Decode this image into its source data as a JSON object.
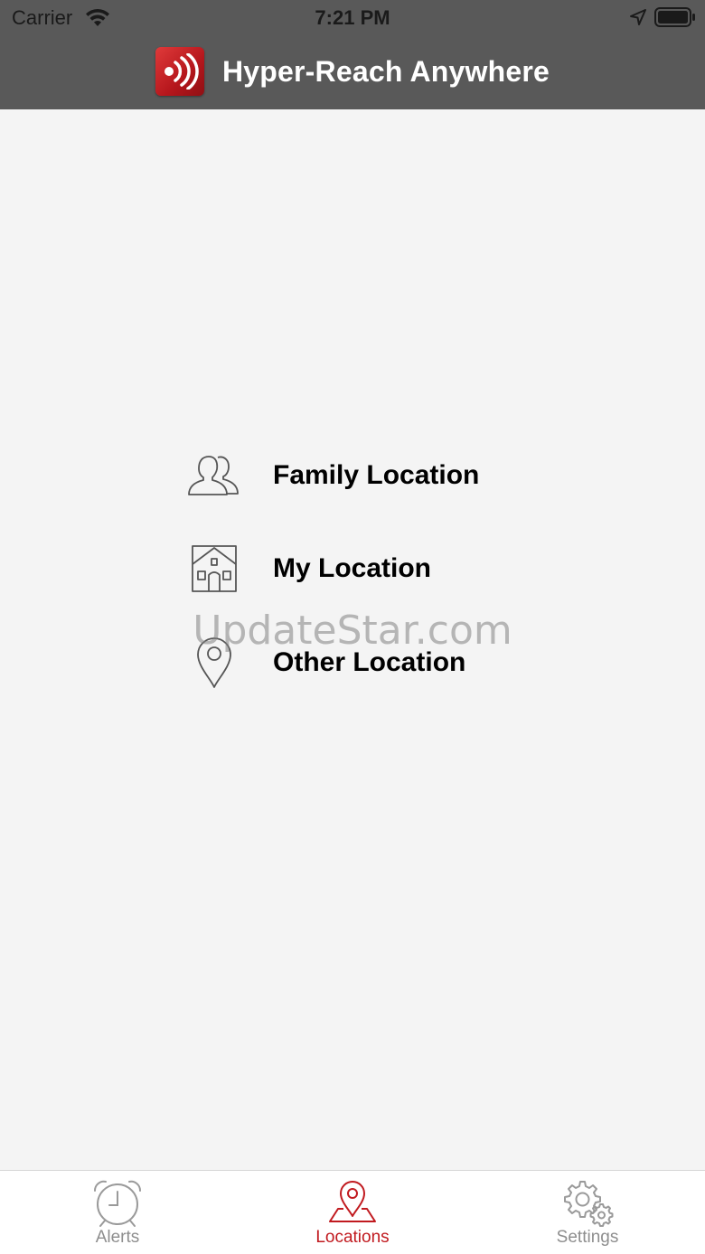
{
  "status_bar": {
    "carrier": "Carrier",
    "time": "7:21 PM"
  },
  "header": {
    "title": "Hyper-Reach Anywhere",
    "logo_icon": "hyper-reach-logo-icon",
    "brand_color": "#c11a1f",
    "bar_color": "#595959"
  },
  "menu": {
    "items": [
      {
        "label": "Family Location",
        "icon": "family-icon"
      },
      {
        "label": "My Location",
        "icon": "house-icon"
      },
      {
        "label": "Other Location",
        "icon": "map-pin-icon"
      }
    ]
  },
  "watermark": "UpdateStar.com",
  "tabs": [
    {
      "label": "Alerts",
      "icon": "alarm-clock-icon",
      "active": false
    },
    {
      "label": "Locations",
      "icon": "location-pin-icon",
      "active": true
    },
    {
      "label": "Settings",
      "icon": "gears-icon",
      "active": false
    }
  ]
}
